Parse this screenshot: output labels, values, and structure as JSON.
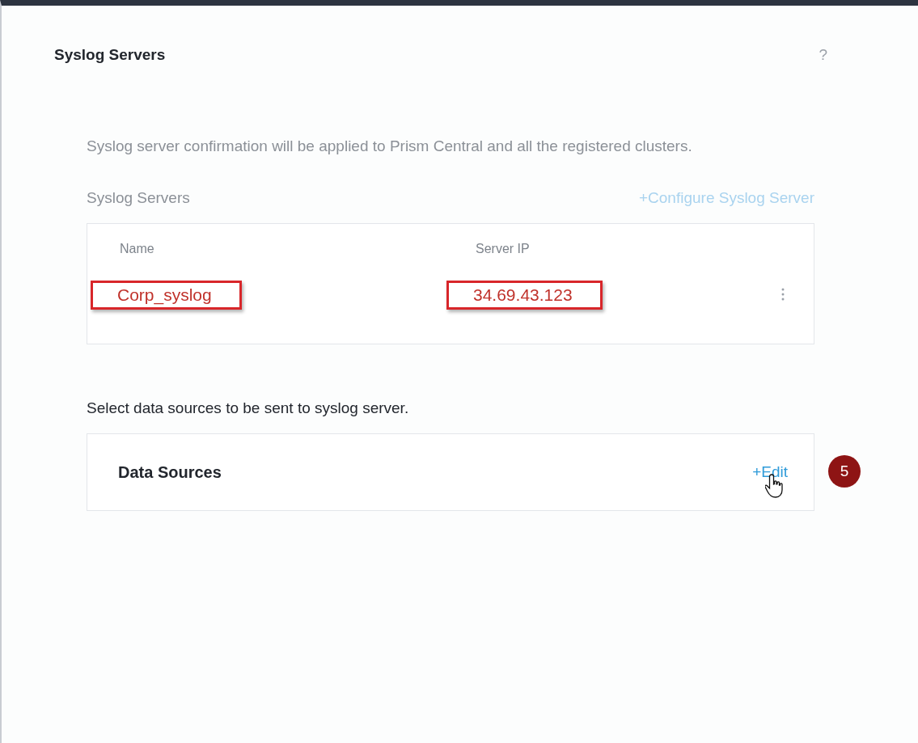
{
  "dialog": {
    "title": "Syslog Servers",
    "help": "?"
  },
  "description": "Syslog server confirmation will be applied to Prism Central and all the registered clusters.",
  "servers": {
    "label": "Syslog Servers",
    "configure_link": "+Configure Syslog Server",
    "columns": [
      "Name",
      "Server IP"
    ],
    "rows": [
      {
        "cells": [
          {
            "text": "Corp_syslog",
            "highlighted": true
          },
          {
            "text": "34.69.43.123",
            "highlighted": true
          }
        ]
      }
    ]
  },
  "data_sources": {
    "prompt": "Select data sources to be sent to syslog server.",
    "title": "Data Sources",
    "edit_link": "+Edit",
    "step_badge": "5"
  }
}
